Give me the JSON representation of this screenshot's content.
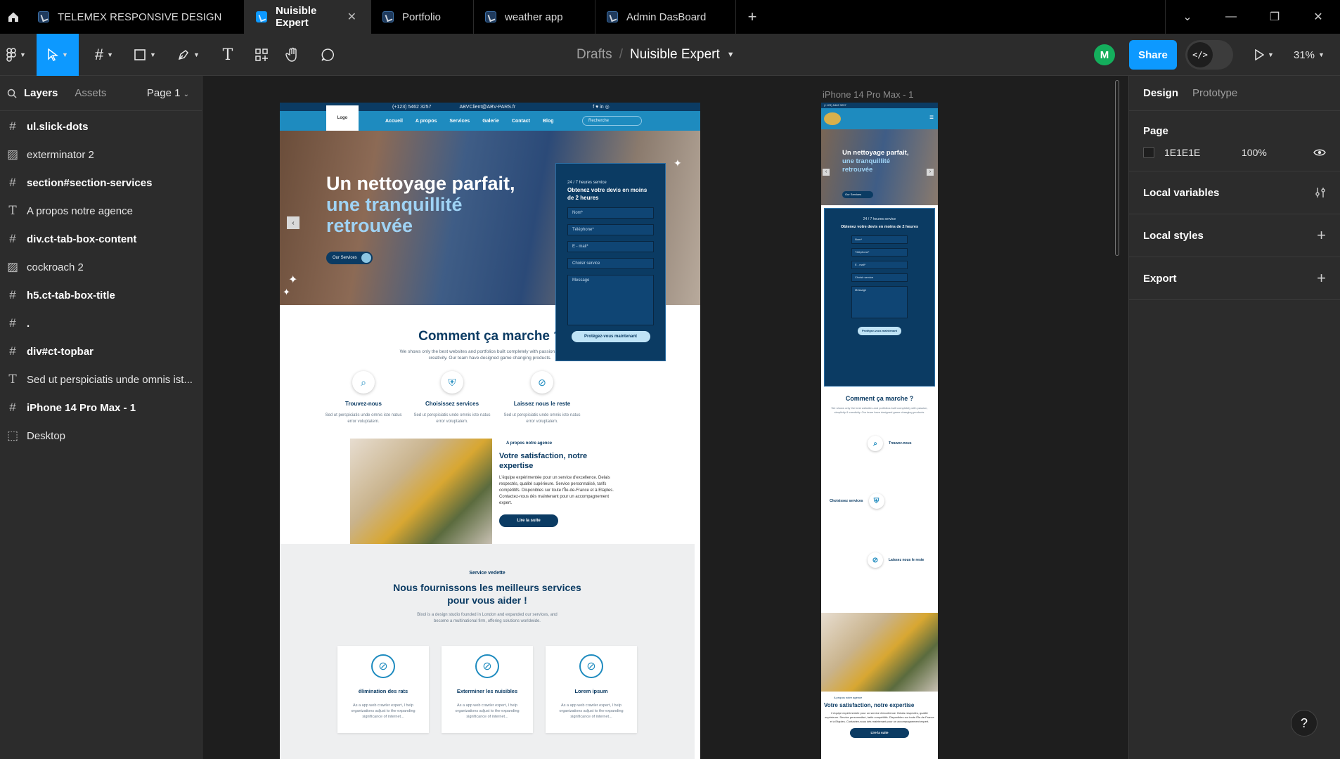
{
  "tabs": [
    {
      "label": "TELEMEX RESPONSIVE DESIGN",
      "active": false
    },
    {
      "label": "Nuisible Expert",
      "active": true
    },
    {
      "label": "Portfolio",
      "active": false
    },
    {
      "label": "weather app",
      "active": false
    },
    {
      "label": "Admin DasBoard",
      "active": false
    }
  ],
  "toolbar": {
    "breadcrumb_folder": "Drafts",
    "breadcrumb_sep": "/",
    "breadcrumb_file": "Nuisible Expert",
    "avatar_initial": "M",
    "share_label": "Share",
    "zoom": "31%",
    "accent": "#0d99ff"
  },
  "left_panel": {
    "tab_layers": "Layers",
    "tab_assets": "Assets",
    "page_selector": "Page 1",
    "layers": [
      {
        "name": "ul.slick-dots",
        "icon": "frame-icon",
        "bold": true
      },
      {
        "name": "exterminator 2",
        "icon": "image-icon",
        "bold": false
      },
      {
        "name": "section#section-services",
        "icon": "frame-icon",
        "bold": true
      },
      {
        "name": "A propos notre agence",
        "icon": "text-icon",
        "bold": false
      },
      {
        "name": "div.ct-tab-box-content",
        "icon": "frame-icon",
        "bold": true
      },
      {
        "name": "cockroach 2",
        "icon": "image-icon",
        "bold": false
      },
      {
        "name": "h5.ct-tab-box-title",
        "icon": "frame-icon",
        "bold": true
      },
      {
        "name": ".",
        "icon": "frame-icon",
        "bold": true
      },
      {
        "name": "div#ct-topbar",
        "icon": "frame-icon",
        "bold": true
      },
      {
        "name": "Sed ut perspiciatis unde omnis ist...",
        "icon": "text-icon",
        "bold": false
      },
      {
        "name": "iPhone 14 Pro Max - 1",
        "icon": "frame-icon",
        "bold": true
      },
      {
        "name": "Desktop",
        "icon": "section-icon",
        "bold": false
      }
    ]
  },
  "right_panel": {
    "tab_design": "Design",
    "tab_prototype": "Prototype",
    "page_title": "Page",
    "page_color": "1E1E1E",
    "page_opacity": "100%",
    "local_variables": "Local variables",
    "local_styles": "Local styles",
    "export": "Export",
    "help": "?"
  },
  "canvas": {
    "mobile_frame_label": "iPhone 14 Pro Max - 1",
    "desktop": {
      "topbar_phone": "(+123) 5462 3257",
      "topbar_email": "ABVClient@ABV-PARS.fr",
      "logo": "Logo",
      "nav": [
        "Accueil",
        "A propos",
        "Services",
        "Galerie",
        "Contact",
        "Blog"
      ],
      "search_placeholder": "Recherche",
      "hero_line1": "Un nettoyage parfait,",
      "hero_line2": "une tranquillité",
      "hero_line3": "retrouvée",
      "hero_button": "Our Services",
      "form_tag": "24 / 7 heures service",
      "form_title": "Obtenez votre devis en moins de 2 heures",
      "form_fields": [
        "Nom*",
        "Téléphone*",
        "E - mail*",
        "Choisir service"
      ],
      "form_message": "Message",
      "form_button": "Protégez-vous maintenant",
      "how_title": "Comment ça marche ?",
      "how_desc": "We shows only the best websites and portfolios built completely with passion, simplicity & creativity. Our team have designed game changing products.",
      "steps": [
        {
          "title": "Trouvez-nous",
          "desc": "Sed ut perspiciatis unde omnis iste natus error voluptatem."
        },
        {
          "title": "Choisissez services",
          "desc": "Sed ut perspiciatis unde omnis iste natus error voluptatem."
        },
        {
          "title": "Laissez nous le reste",
          "desc": "Sed ut perspiciatis unde omnis iste natus error voluptatem."
        }
      ],
      "about_tag": "A propos notre agence",
      "about_title": "Votre satisfaction, notre expertise",
      "about_desc": "L'équipe expérimentée pour un service d'excellence. Delais respectés, qualité supérieure. Service personnalisé, tarifs compétitifs. Disponibles sur toute l'Île-de-France et à Etaples. Contactez-nous dès maintenant pour un accompagnement expert.",
      "about_button": "Lire la suite",
      "services_tag": "Service vedette",
      "services_title": "Nous fournissons les meilleurs services pour vous aider !",
      "services_desc": "Bixol is a design studio founded in London and expanded our services, and become a multinational firm, offering solutions worldwide.",
      "cards": [
        {
          "title": "élimination des rats",
          "desc": "As a app web crawler expert, I help organizations adjust to the expanding significance of internet..."
        },
        {
          "title": "Exterminer les nuisibles",
          "desc": "As a app web crawler expert, I help organizations adjust to the expanding significance of internet..."
        },
        {
          "title": "Lorem ipsum",
          "desc": "As a app web crawler expert, I help organizations adjust to the expanding significance of internet..."
        }
      ]
    },
    "mobile": {
      "topbar": "(+123) 5462 3257",
      "hero": "Un nettoyage parfait,",
      "hero2": "une tranquillité retrouvée",
      "hero_button": "Our Services",
      "form_tag": "24 / 7 heures service",
      "form_title": "Obtenez votre devis en moins de 2 heures",
      "form_fields": [
        "Nom*",
        "Téléphone*",
        "E - mail*",
        "Choisir service"
      ],
      "form_message": "Message",
      "form_button": "Protégez-vous maintenant",
      "how_title": "Comment ça marche ?",
      "how_desc": "We shows only the best websites and portfolios built completely with passion, simplicity & creativity. Our team have designed game changing products.",
      "steps": [
        "Trouvez-nous",
        "Choisissez services",
        "Laissez nous le reste"
      ],
      "about_tag": "A propos notre agence",
      "about_title": "Votre satisfaction, notre expertise",
      "about_desc": "L'équipe expérimentée pour un service d'excellence. Delais respectés, qualité supérieure. Service personnalisé, tarifs compétitifs. Disponibles sur toute l'Île-de-France et à Etaples. Contactez-nous dès maintenant pour un accompagnement expert.",
      "about_button": "Lire la suite"
    }
  }
}
